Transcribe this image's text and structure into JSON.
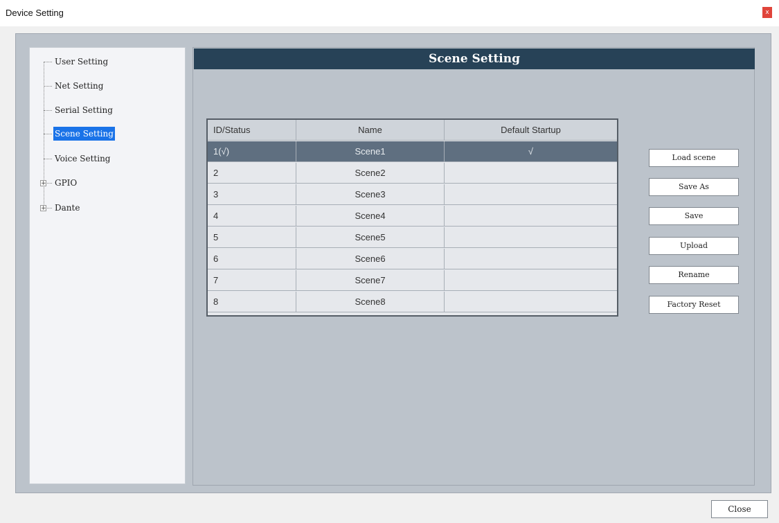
{
  "window": {
    "title": "Device Setting",
    "close_glyph": "x"
  },
  "tree": {
    "items": [
      {
        "label": "User Setting",
        "expandable": false
      },
      {
        "label": "Net Setting",
        "expandable": false
      },
      {
        "label": "Serial Setting",
        "expandable": false
      },
      {
        "label": "Scene Setting",
        "expandable": false,
        "selected": true
      },
      {
        "label": "Voice Setting",
        "expandable": false
      },
      {
        "label": "GPIO",
        "expandable": true
      },
      {
        "label": "Dante",
        "expandable": true
      }
    ],
    "expander_glyph": "+"
  },
  "panel": {
    "title": "Scene Setting"
  },
  "table": {
    "headers": [
      "ID/Status",
      "Name",
      "Default Startup"
    ],
    "rows": [
      [
        "1(√)",
        "Scene1",
        "√"
      ],
      [
        "2",
        "Scene2",
        ""
      ],
      [
        "3",
        "Scene3",
        ""
      ],
      [
        "4",
        "Scene4",
        ""
      ],
      [
        "5",
        "Scene5",
        ""
      ],
      [
        "6",
        "Scene6",
        ""
      ],
      [
        "7",
        "Scene7",
        ""
      ],
      [
        "8",
        "Scene8",
        ""
      ]
    ]
  },
  "buttons": {
    "load_scene": "Load scene",
    "save_as": "Save As",
    "save": "Save",
    "upload": "Upload",
    "rename": "Rename",
    "factory_reset": "Factory Reset"
  },
  "footer": {
    "close_label": "Close"
  }
}
